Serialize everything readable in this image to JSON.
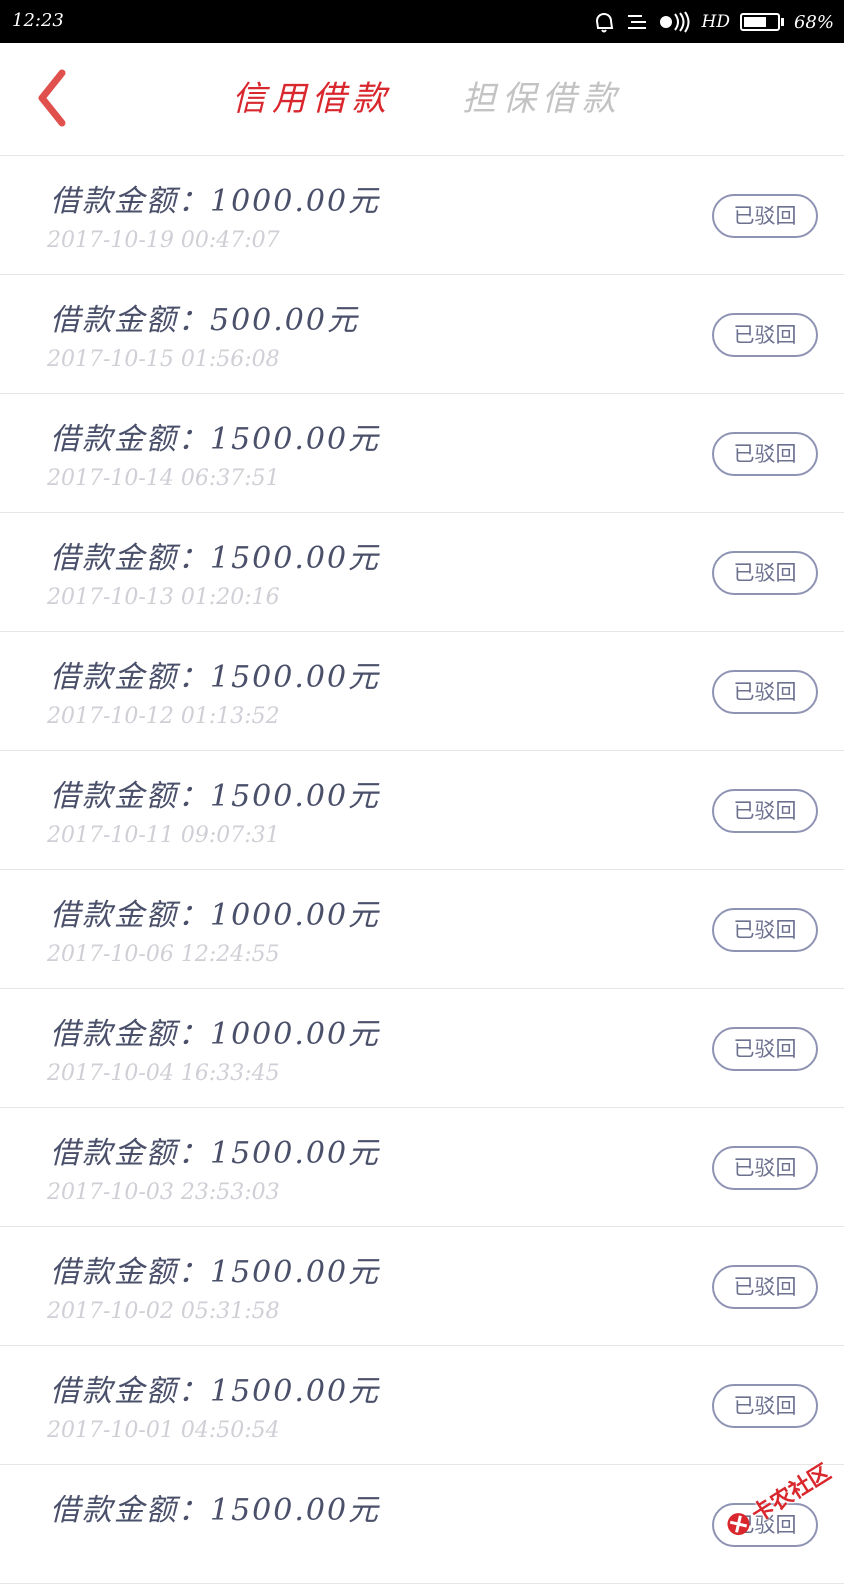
{
  "status_bar": {
    "time": "12:23",
    "network": "HD",
    "battery_level": 0.68,
    "battery": "68%",
    "icons": [
      "notification-bell-icon",
      "menu-lines-icon",
      "signal-waves-icon"
    ]
  },
  "header": {
    "back_icon": "chevron-left-icon",
    "tabs": [
      {
        "label": "信用借款",
        "active": true
      },
      {
        "label": "担保借款",
        "active": false
      }
    ],
    "accent_color": "#d9272e"
  },
  "loans": [
    {
      "amount": "借款金额：1000.00元",
      "time": "2017-10-19 00:47:07",
      "status": "已驳回"
    },
    {
      "amount": "借款金额：500.00元",
      "time": "2017-10-15 01:56:08",
      "status": "已驳回"
    },
    {
      "amount": "借款金额：1500.00元",
      "time": "2017-10-14 06:37:51",
      "status": "已驳回"
    },
    {
      "amount": "借款金额：1500.00元",
      "time": "2017-10-13 01:20:16",
      "status": "已驳回"
    },
    {
      "amount": "借款金额：1500.00元",
      "time": "2017-10-12 01:13:52",
      "status": "已驳回"
    },
    {
      "amount": "借款金额：1500.00元",
      "time": "2017-10-11 09:07:31",
      "status": "已驳回"
    },
    {
      "amount": "借款金额：1000.00元",
      "time": "2017-10-06 12:24:55",
      "status": "已驳回"
    },
    {
      "amount": "借款金额：1000.00元",
      "time": "2017-10-04 16:33:45",
      "status": "已驳回"
    },
    {
      "amount": "借款金额：1500.00元",
      "time": "2017-10-03 23:53:03",
      "status": "已驳回"
    },
    {
      "amount": "借款金额：1500.00元",
      "time": "2017-10-02 05:31:58",
      "status": "已驳回"
    },
    {
      "amount": "借款金额：1500.00元",
      "time": "2017-10-01 04:50:54",
      "status": "已驳回"
    },
    {
      "amount": "借款金额：1500.00元",
      "time": "",
      "status": "已驳回"
    }
  ],
  "watermark": {
    "text": "卡农社区",
    "icon": "kanong-logo-icon"
  }
}
